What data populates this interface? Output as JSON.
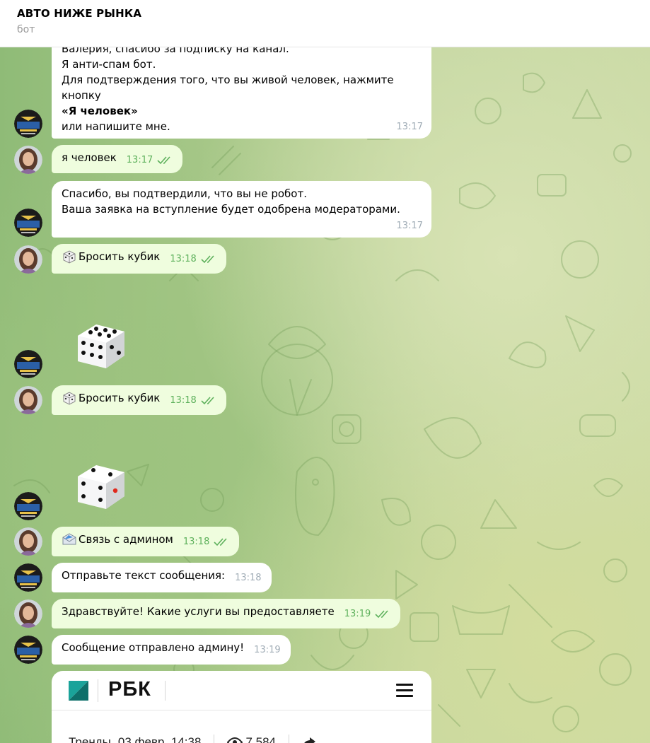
{
  "header": {
    "title": "АВТО НИЖЕ РЫНКА",
    "subtitle": "бот"
  },
  "colors": {
    "incoming_bubble": "#ffffff",
    "outgoing_bubble": "#effdde",
    "time_out": "#5eb15c",
    "time_in": "#a0acb6"
  },
  "messages": [
    {
      "lines": [
        "Валерия, спасибо за подписку на канал.",
        "Я анти-спам бот.",
        "Для подтверждения того, что вы живой человек, нажмите",
        "кнопку"
      ],
      "bold": "«Я человек»",
      "tail": "или напишите мне.",
      "time": "13:17"
    },
    {
      "text": "я человек",
      "time": "13:17"
    },
    {
      "lines": [
        "Спасибо, вы подтвердили, что вы не робот.",
        "Ваша заявка на вступление будет одобрена модераторами."
      ],
      "time": "13:17"
    },
    {
      "text": "Бросить кубик",
      "time": "13:18",
      "icon": "dice-emoji-icon"
    },
    {
      "text": "Бросить кубик",
      "time": "13:18",
      "icon": "dice-emoji-icon"
    },
    {
      "text": "Связь с админом",
      "time": "13:18",
      "icon": "envelope-emoji-icon"
    },
    {
      "text": "Отправьте текст сообщения:",
      "time": "13:18"
    },
    {
      "text": "Здравствуйте! Какие услуги вы предоставляете",
      "time": "13:19"
    },
    {
      "text": "Сообщение отправлено админу!",
      "time": "13:19"
    }
  ],
  "dice_rolls": [
    6,
    5
  ],
  "rbc_preview": {
    "logo": "РБК",
    "meta_section": "Тренды",
    "meta_date": "03 февр. 14:38",
    "views": "7 584"
  }
}
